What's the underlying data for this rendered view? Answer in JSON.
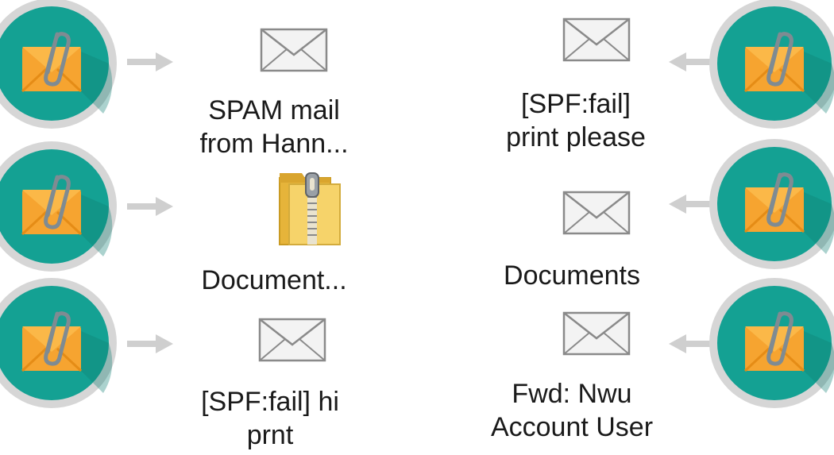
{
  "colors": {
    "badge_ring": "#d4d4d4",
    "badge_fill": "#14a193",
    "badge_shadow": "#0e7f74",
    "envelope": "#f6a430",
    "envelope_dark": "#e58c16",
    "paperclip": "#7f8b92",
    "arrow": "#cfcfcf",
    "mail_icon_stroke": "#8a8a8a",
    "zip_folder": "#f2c84b"
  },
  "left_column": [
    {
      "icon": "mail-icon",
      "label_lines": [
        "SPAM mail",
        "from Hann..."
      ]
    },
    {
      "icon": "zip-folder-icon",
      "label_lines": [
        "Document..."
      ]
    },
    {
      "icon": "mail-icon",
      "label_lines": [
        "[SPF:fail] hi",
        "prnt"
      ]
    }
  ],
  "right_column": [
    {
      "icon": "mail-icon",
      "label_lines": [
        "[SPF:fail]",
        "print please"
      ]
    },
    {
      "icon": "mail-icon",
      "label_lines": [
        "Documents"
      ]
    },
    {
      "icon": "mail-icon",
      "label_lines": [
        "Fwd: Nwu",
        "Account User"
      ]
    }
  ]
}
